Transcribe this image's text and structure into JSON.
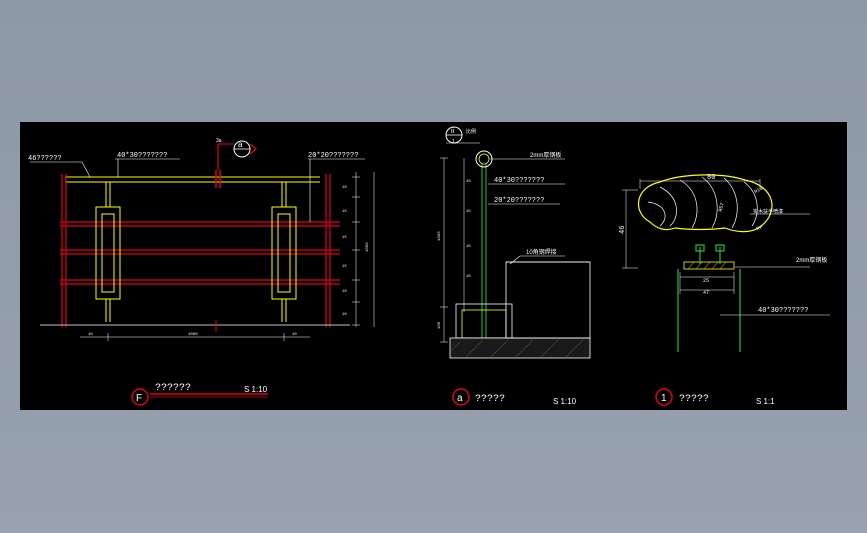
{
  "colors": {
    "background": "#8e99a8",
    "canvas": "#000000",
    "red": "#e0001b",
    "yellow": "#ffff00",
    "green": "#22c33a",
    "white": "#ffffff",
    "cyan": "#00ffff"
  },
  "panel_f": {
    "label_top_left": "46??????",
    "label_top_mid": "40*30???????",
    "label_top_right": "20*20???????",
    "marker_letter": "F",
    "title": "??????",
    "scale": "S 1:10",
    "section_marker": "a",
    "dim_bottom_mid": "1000",
    "dim_side_right": "1000"
  },
  "panel_a": {
    "marker_top": "ii",
    "label_ref_top": "1",
    "label_plate": "2mm厚钢板",
    "label_tube1": "40*30???????",
    "label_tube2": "20*20???????",
    "label_steel": "10角钢焊接",
    "marker_letter": "a",
    "title": "?????",
    "scale": "S 1:10"
  },
  "panel_1": {
    "dim_width": "80",
    "dim_height": "46",
    "dim_r10": "R10",
    "dim_r57": "R57",
    "dim_r7": "R7",
    "label_wood": "实木扶手喷漆",
    "label_plate": "2mm厚钢板",
    "dim_25": "25",
    "dim_47": "47",
    "label_tube": "40*30???????",
    "marker_letter": "1",
    "title": "?????",
    "scale": "S 1:1"
  }
}
